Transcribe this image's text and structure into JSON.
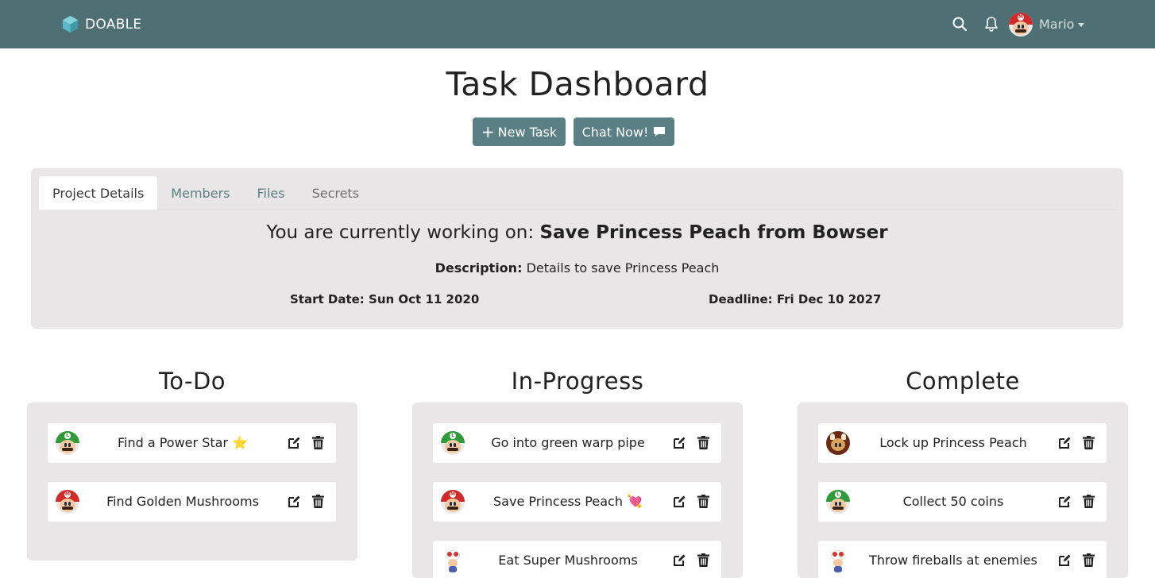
{
  "navbar": {
    "brand": "DOABLE",
    "user_name": "Mario"
  },
  "header": {
    "title": "Task Dashboard",
    "new_task_label": "New Task",
    "chat_label": "Chat Now!"
  },
  "project": {
    "tabs": [
      "Project Details",
      "Members",
      "Files",
      "Secrets"
    ],
    "working_prefix": "You are currently working on:",
    "project_name": "Save Princess Peach from Bowser",
    "description_label": "Description:",
    "description": "Details to save Princess Peach",
    "start_date": "Start Date: Sun Oct 11 2020",
    "deadline": "Deadline: Fri Dec 10 2027"
  },
  "columns": [
    {
      "title": "To-Do",
      "tasks": [
        {
          "avatar": "luigi",
          "text": "Find a Power Star ⭐"
        },
        {
          "avatar": "mario",
          "text": "Find Golden Mushrooms"
        }
      ]
    },
    {
      "title": "In-Progress",
      "tasks": [
        {
          "avatar": "luigi",
          "text": "Go into green warp pipe"
        },
        {
          "avatar": "mario",
          "text": "Save Princess Peach 💘"
        },
        {
          "avatar": "toad",
          "text": "Eat Super Mushrooms"
        }
      ]
    },
    {
      "title": "Complete",
      "tasks": [
        {
          "avatar": "bowser",
          "text": "Lock up Princess Peach"
        },
        {
          "avatar": "luigi",
          "text": "Collect 50 coins"
        },
        {
          "avatar": "toad",
          "text": "Throw fireballs at enemies"
        }
      ]
    }
  ],
  "colors": {
    "navbar": "#4e6f73",
    "button": "#5a7f84",
    "panel": "#e8e6e6"
  }
}
